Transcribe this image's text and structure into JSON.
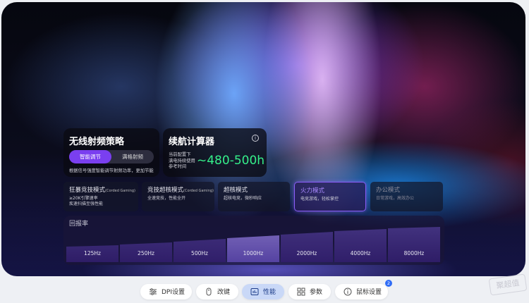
{
  "wireless": {
    "title": "无线射频策略",
    "options": [
      "智能调节",
      "满格射频"
    ],
    "selected": "智能调节",
    "note": "根据信号强度智能调节射频功率，更加节能"
  },
  "battery": {
    "title": "续航计算器",
    "meta_lines": [
      "当前配置下",
      "满电持续使用",
      "参考时间"
    ],
    "value": "~480-500h",
    "value_color": "#35f08a"
  },
  "modes": [
    {
      "name": "狂暴竞技模式",
      "tag": "(Corded Gaming)",
      "desc": [
        "≥20K引擎速率",
        "疾速扫描至强性能"
      ],
      "state": "normal"
    },
    {
      "name": "竞技超核模式",
      "tag": "(Corded Gaming)",
      "desc": [
        "全速竞技，性能全开"
      ],
      "state": "normal"
    },
    {
      "name": "超核模式",
      "tag": "",
      "desc": [
        "超核电竞，微秒响应"
      ],
      "state": "normal"
    },
    {
      "name": "火力模式",
      "tag": "",
      "desc": [
        "电竞游戏，轻松掌控"
      ],
      "state": "selected"
    },
    {
      "name": "办公模式",
      "tag": "",
      "desc": [
        "日常游戏，高效办公"
      ],
      "state": "dim"
    }
  ],
  "polling": {
    "label": "回报率",
    "rates": [
      "125Hz",
      "250Hz",
      "500Hz",
      "1000Hz",
      "2000Hz",
      "4000Hz",
      "8000Hz"
    ],
    "selected": "1000Hz"
  },
  "nav": [
    {
      "label": "DPI设置",
      "icon": "dpi-icon"
    },
    {
      "label": "改键",
      "icon": "mouse-icon"
    },
    {
      "label": "性能",
      "icon": "performance-icon",
      "active": true
    },
    {
      "label": "参数",
      "icon": "grid-icon"
    },
    {
      "label": "鼠标设置",
      "icon": "info-icon",
      "badge": "2"
    }
  ],
  "watermark": "聚超值",
  "colors": {
    "accent": "#7a3ff0",
    "selected_border": "#8a5cf6",
    "nav_active": "#c9d8f7"
  }
}
